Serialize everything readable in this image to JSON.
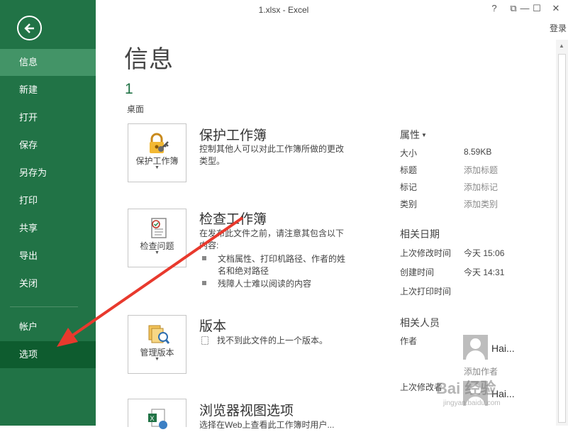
{
  "titlebar": {
    "title": "1.xlsx - Excel",
    "help": "?",
    "restore": "⧉",
    "minimize": "—",
    "maximize": "☐",
    "close": "✕",
    "signin": "登录"
  },
  "sidebar": {
    "items": [
      {
        "label": "信息"
      },
      {
        "label": "新建"
      },
      {
        "label": "打开"
      },
      {
        "label": "保存"
      },
      {
        "label": "另存为"
      },
      {
        "label": "打印"
      },
      {
        "label": "共享"
      },
      {
        "label": "导出"
      },
      {
        "label": "关闭"
      },
      {
        "label": "帐户"
      },
      {
        "label": "选项"
      }
    ],
    "selected": "信息",
    "highlighted": "选项"
  },
  "main": {
    "title": "信息",
    "doc_name": "1",
    "doc_location": "桌面",
    "protect": {
      "tile_label": "保护工作簿",
      "title": "保护工作簿",
      "desc": "控制其他人可以对此工作簿所做的更改类型。"
    },
    "inspect": {
      "tile_label": "检查问题",
      "title": "检查工作簿",
      "desc": "在发布此文件之前，请注意其包含以下内容:",
      "bullets": [
        "文档属性、打印机路径、作者的姓名和绝对路径",
        "残障人士难以阅读的内容"
      ]
    },
    "versions": {
      "tile_label": "管理版本",
      "title": "版本",
      "desc": "找不到此文件的上一个版本。"
    },
    "browser": {
      "title": "浏览器视图选项",
      "desc": "选择在Web上查看此工作簿时用户..."
    }
  },
  "properties": {
    "header": "属性",
    "rows": [
      {
        "label": "大小",
        "value": "8.59KB"
      },
      {
        "label": "标题",
        "value": "添加标题"
      },
      {
        "label": "标记",
        "value": "添加标记"
      },
      {
        "label": "类别",
        "value": "添加类别"
      }
    ],
    "dates_header": "相关日期",
    "dates": [
      {
        "label": "上次修改时间",
        "value": "今天 15:06"
      },
      {
        "label": "创建时间",
        "value": "今天 14:31"
      },
      {
        "label": "上次打印时间",
        "value": ""
      }
    ],
    "people_header": "相关人员",
    "author_label": "作者",
    "author_name": "Hai...",
    "add_author": "添加作者",
    "modified_by_label": "上次修改者",
    "modified_by_name": "Hai..."
  },
  "watermark": {
    "text": "Bai 经验",
    "sub": "jingyan.baidu.com"
  },
  "colors": {
    "sidebar": "#217346",
    "selected": "#439467",
    "highlight": "#0e5c2f",
    "arrow": "#e8392d"
  }
}
